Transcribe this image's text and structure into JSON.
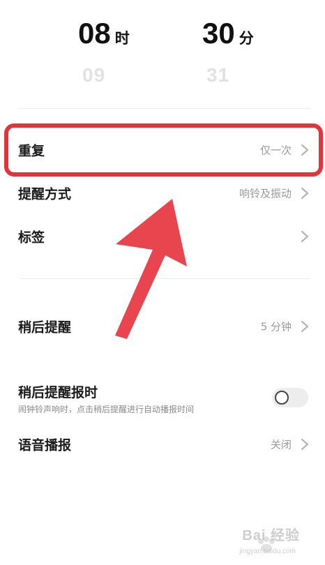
{
  "time_picker": {
    "hour": {
      "selected": "08",
      "unit": "时",
      "next": "09"
    },
    "minute": {
      "selected": "30",
      "unit": "分",
      "next": "31"
    }
  },
  "settings": {
    "repeat": {
      "label": "重复",
      "value": "仅一次"
    },
    "reminder_method": {
      "label": "提醒方式",
      "value": "响铃及振动"
    },
    "tag": {
      "label": "标签"
    },
    "snooze": {
      "label": "稍后提醒",
      "value": "5 分钟"
    },
    "snooze_announce": {
      "label": "稍后提醒报时",
      "description": "闹钟铃声响时，点击稍后提醒进行自动播报时间",
      "enabled": false
    },
    "voice_broadcast": {
      "label": "语音播报",
      "value": "关闭"
    }
  },
  "annotation": {
    "highlight_color": "#e5333a",
    "arrow_color": "#e8454f"
  },
  "watermark": {
    "brand": "Bai 经验",
    "url": "jingyan.baidu.com"
  }
}
